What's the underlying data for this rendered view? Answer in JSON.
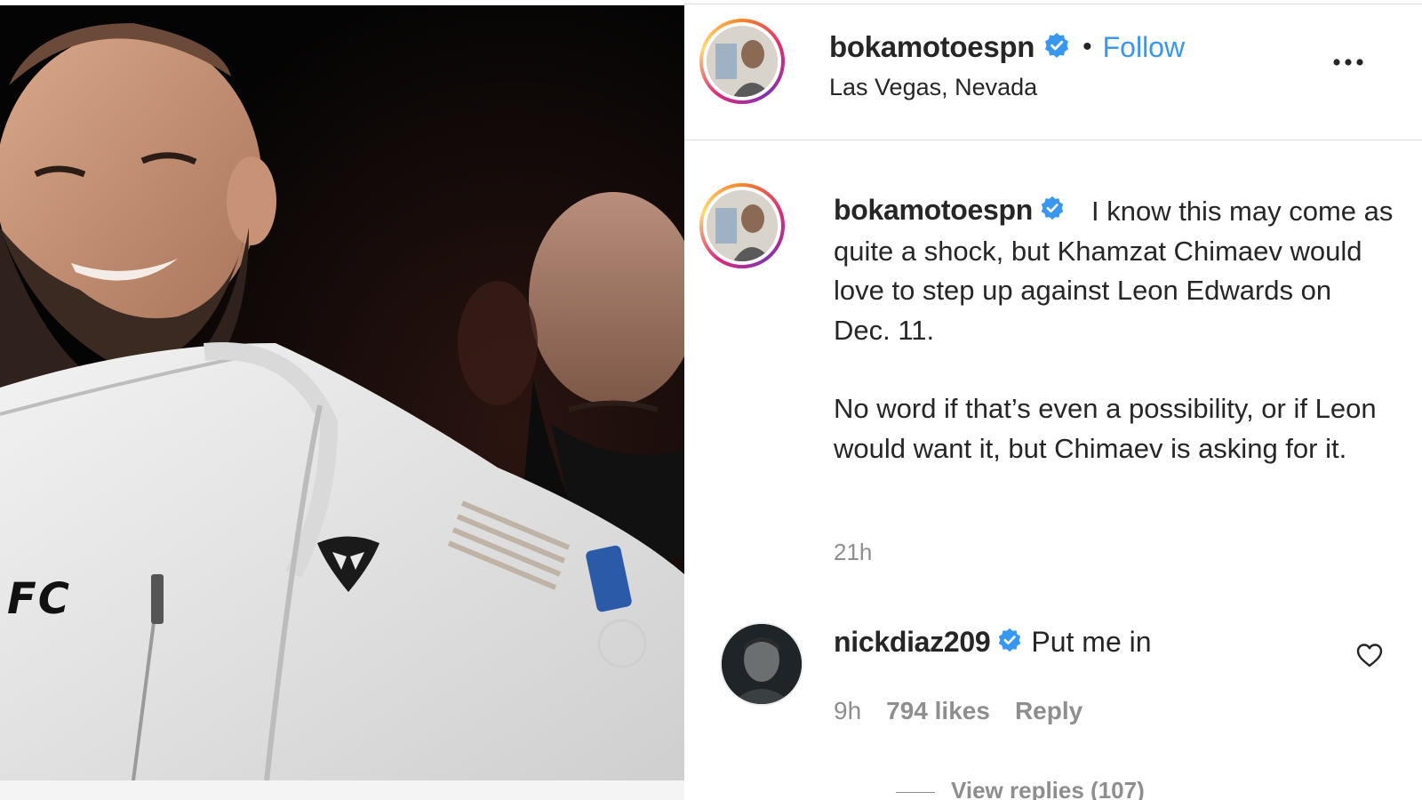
{
  "post": {
    "author": {
      "username": "bokamotoespn",
      "verified": true,
      "follow_label": "Follow",
      "separator": "•",
      "location": "Las Vegas, Nevada"
    },
    "more_options_icon": "more-horizontal-icon",
    "caption": {
      "username": "bokamotoespn",
      "paragraph_1": "I know this may come as quite a shock, but Khamzat Chimaev would love to step up against Leon Edwards on Dec. 11.",
      "paragraph_2": "No word if that’s even a possibility, or if Leon would want it, but Chimaev is asking for it.",
      "time": "21h"
    },
    "comments": [
      {
        "username": "nickdiaz209",
        "verified": true,
        "text": "Put me in",
        "time": "9h",
        "likes": "794 likes",
        "reply_label": "Reply",
        "like_icon": "heart-outline-icon"
      }
    ],
    "view_replies_label": "View replies (107)"
  },
  "photo": {
    "jacket_logo_text": "FC"
  },
  "colors": {
    "link_blue": "#3897f0",
    "verified_blue": "#3897f0",
    "muted_text": "#8e8e8e",
    "primary_text": "#262626",
    "divider": "#dbdbdb"
  }
}
